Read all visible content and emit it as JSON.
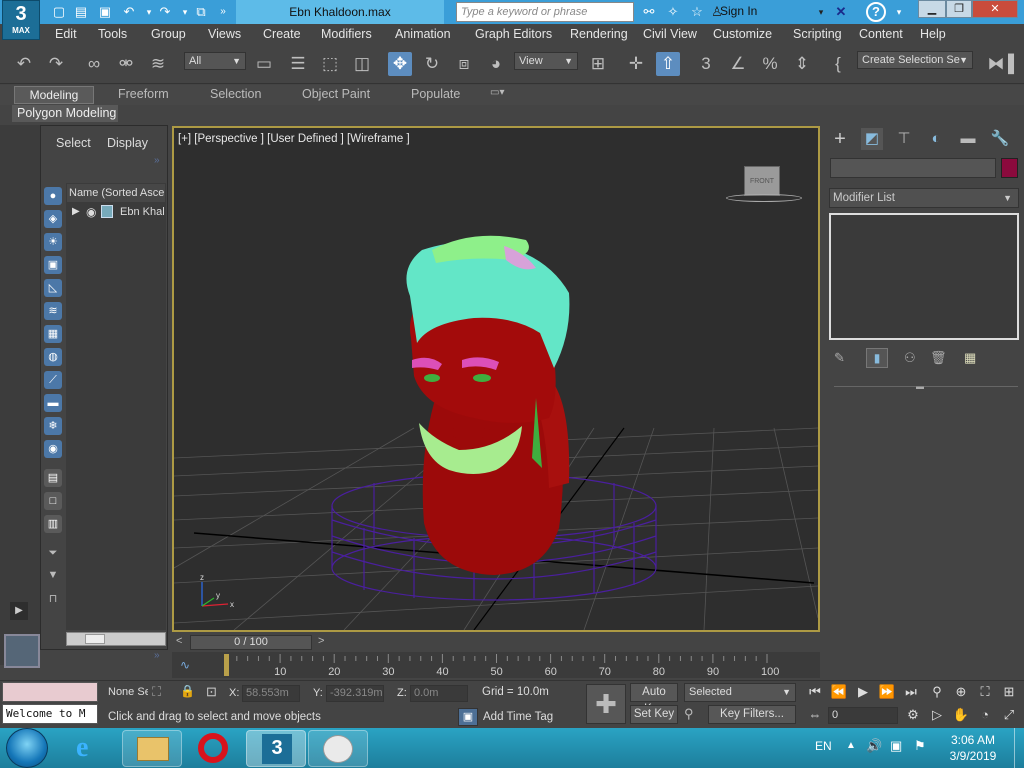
{
  "app": {
    "logo_number": "3",
    "logo_text": "MAX",
    "document_title": "Ebn Khaldoon.max",
    "search_placeholder": "Type a keyword or phrase",
    "sign_in": "Sign In",
    "help_icon": "?"
  },
  "menu": [
    "Edit",
    "Tools",
    "Group",
    "Views",
    "Create",
    "Modifiers",
    "Animation",
    "Graph Editors",
    "Rendering",
    "Civil View",
    "Customize",
    "Scripting",
    "Content",
    "Help"
  ],
  "toolbar": {
    "filter_dropdown": "All",
    "coord_dropdown": "View",
    "selection_set": "Create Selection Se"
  },
  "ribbon": {
    "tabs": [
      "Modeling",
      "Freeform",
      "Selection",
      "Object Paint",
      "Populate"
    ],
    "active_tab": "Modeling",
    "panel_label": "Polygon Modeling"
  },
  "scene_explorer": {
    "tabs": [
      "Select",
      "Display"
    ],
    "column_header": "Name (Sorted Ascending)",
    "items": [
      {
        "name": "Ebn Khaldoon"
      }
    ]
  },
  "viewport": {
    "label": "[+] [Perspective ] [User Defined ] [Wireframe ]",
    "viewcube_label": "FRONT",
    "axis_x": "x",
    "axis_y": "y",
    "axis_z": "z"
  },
  "timeline": {
    "slider_text": "0 / 100",
    "current_frame": 0,
    "total_frames": 100,
    "ticks": [
      "10",
      "20",
      "30",
      "40",
      "50",
      "60",
      "70",
      "80",
      "90",
      "100"
    ]
  },
  "command_panel": {
    "modifier_list": "Modifier List",
    "object_color": "#8b0a3d"
  },
  "status": {
    "maxscript_text": "Welcome to M",
    "selection_text": "None Se",
    "x_label": "X:",
    "x_value": "58.553m",
    "y_label": "Y:",
    "y_value": "-392.319m",
    "z_label": "Z:",
    "z_value": "0.0m",
    "grid": "Grid = 10.0m",
    "prompt": "Click and drag to select and move objects",
    "add_time_tag": "Add Time Tag",
    "auto_key": "Auto Key",
    "set_key": "Set Key",
    "key_mode": "Selected",
    "key_filters": "Key Filters...",
    "frame_value": "0"
  },
  "taskbar": {
    "language": "EN",
    "time": "3:06 AM",
    "date": "3/9/2019"
  }
}
